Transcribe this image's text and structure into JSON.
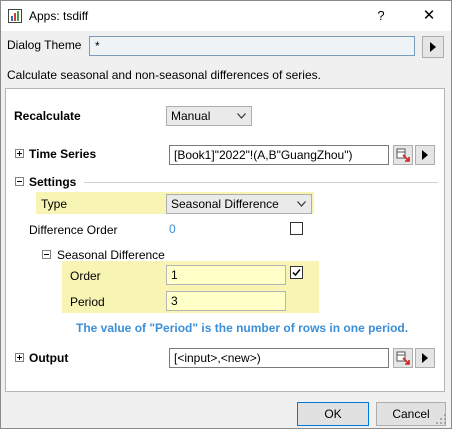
{
  "window": {
    "title": "Apps: tsdiff",
    "help": "?",
    "close": "✕"
  },
  "theme": {
    "label": "Dialog Theme",
    "value": "*"
  },
  "description": "Calculate seasonal and non-seasonal differences of series.",
  "recalculate": {
    "label": "Recalculate",
    "value": "Manual"
  },
  "time_series": {
    "label": "Time Series",
    "value": "[Book1]\"2022\"!(A,B\"GuangZhou\")"
  },
  "settings": {
    "label": "Settings",
    "type": {
      "label": "Type",
      "value": "Seasonal Difference"
    },
    "difference_order": {
      "label": "Difference Order",
      "value": "0"
    },
    "seasonal": {
      "label": "Seasonal Difference",
      "order": {
        "label": "Order",
        "value": "1"
      },
      "period": {
        "label": "Period",
        "value": "3"
      },
      "note": "The value of \"Period\" is the number of rows in one period."
    }
  },
  "output": {
    "label": "Output",
    "value": "[<input>,<new>)"
  },
  "buttons": {
    "ok": "OK",
    "cancel": "Cancel"
  },
  "colors": {
    "highlight": "#f8f4b4",
    "input_yellow": "#ffffc8",
    "note_blue": "#3b8fd8",
    "accent": "#0078d7"
  }
}
